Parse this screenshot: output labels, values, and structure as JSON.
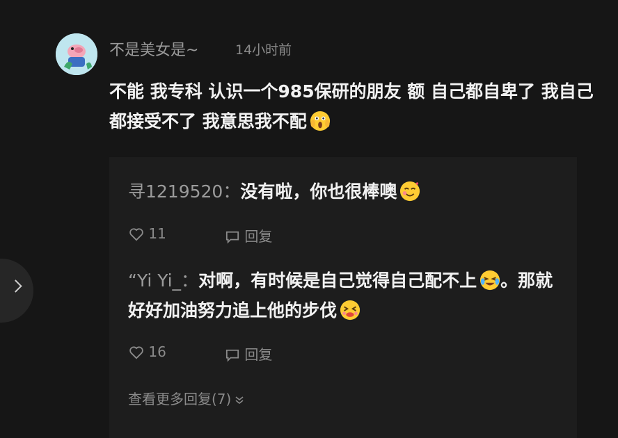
{
  "comment": {
    "username": "不是美女是~",
    "timestamp": "14小时前",
    "text": "不能 我专科 认识一个985保研的朋友 额 自己都自卑了 我自己都接受不了 我意思我不配"
  },
  "replies": [
    {
      "author": "寻1219520：",
      "text": "没有啦，你也很棒噢",
      "likes": "11",
      "reply_label": "回复"
    },
    {
      "author": "“Yi Yi_：",
      "text_part1": "对啊，有时候是自己觉得自己配不上",
      "text_part2": "。那就好好加油努力追上他的步伐",
      "likes": "16",
      "reply_label": "回复"
    }
  ],
  "more_replies": "查看更多回复(7)",
  "icons": {
    "nav": "chevron-right-icon",
    "like": "heart-outline-icon",
    "reply": "speech-bubble-icon",
    "expand": "double-chevron-down-icon"
  }
}
